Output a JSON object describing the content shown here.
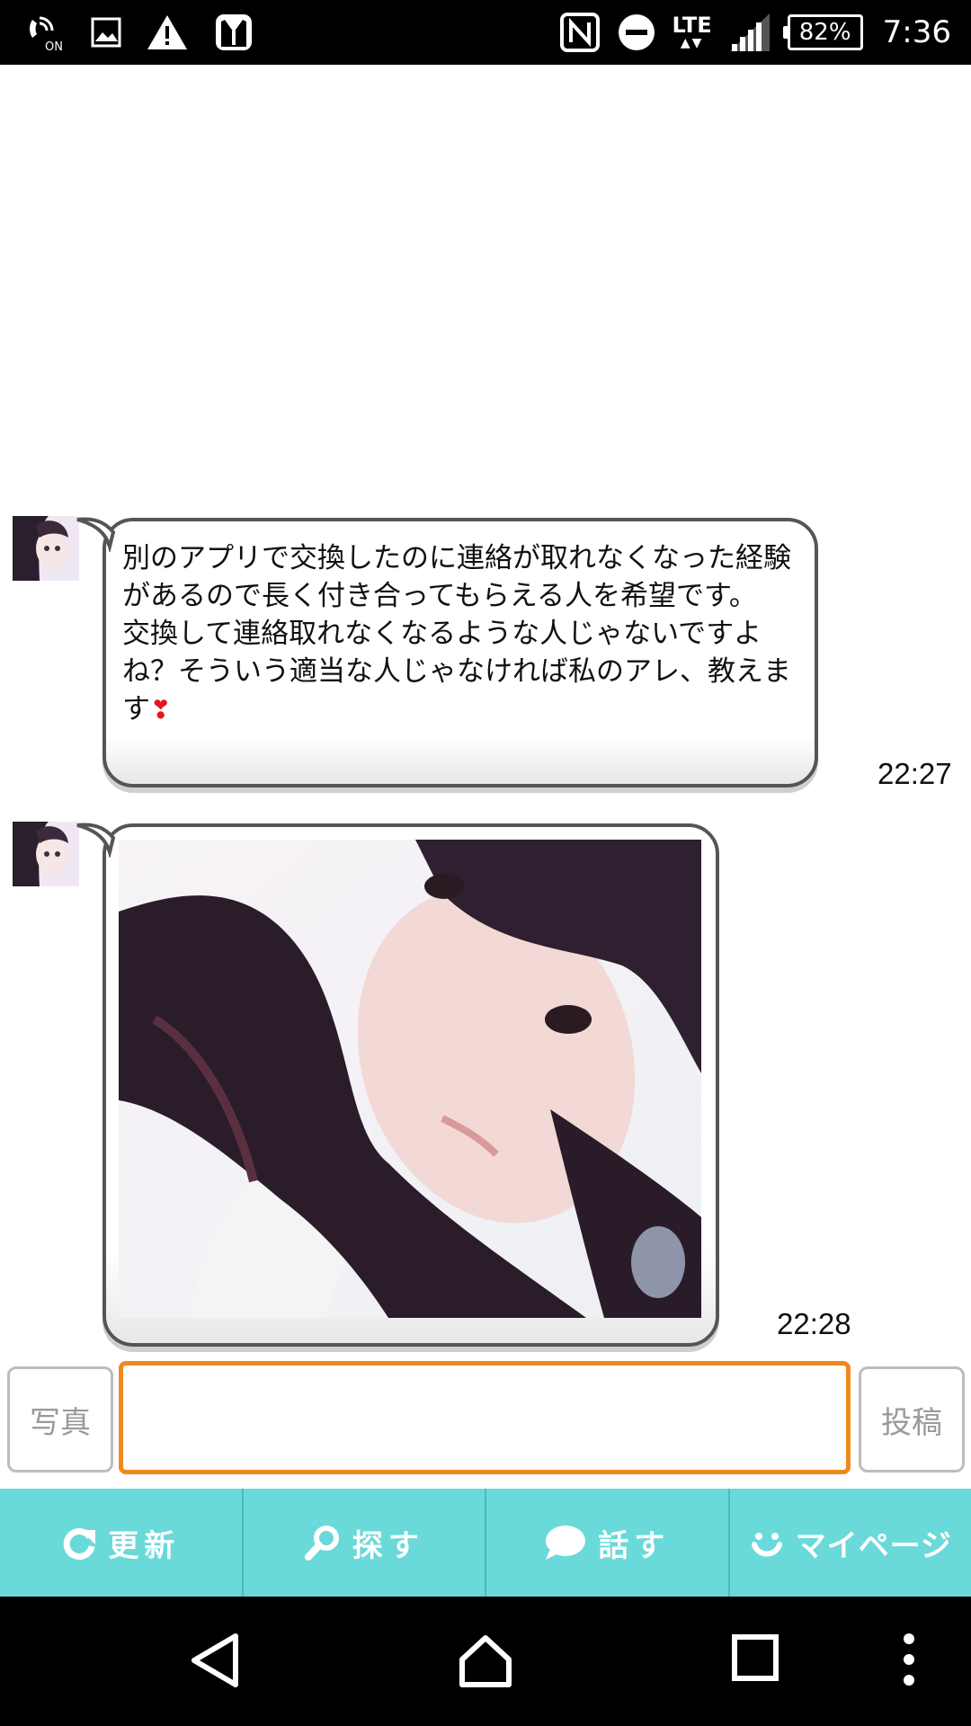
{
  "status_bar": {
    "time": "7:36",
    "battery": "82%",
    "network": "LTE",
    "nfc_label": "N",
    "icons_left": [
      "wifi-calling-icon",
      "image-icon",
      "warning-icon",
      "tuxedo-icon"
    ],
    "icons_right": [
      "nfc-icon",
      "do-not-disturb-icon",
      "lte-icon",
      "signal-icon",
      "battery-icon"
    ]
  },
  "chat": {
    "messages": [
      {
        "type": "text",
        "text": "別のアプリで交換したのに連絡が取れなくなった経験があるので長く付き合ってもらえる人を希望です。\n交換して連絡取れなくなるような人じゃないですよね？そういう適当な人じゃなければ私のアレ、教えます",
        "emoji": "❣",
        "time": "22:27"
      },
      {
        "type": "photo",
        "time": "22:28"
      }
    ]
  },
  "input_bar": {
    "photo_button": "写真",
    "message_value": "",
    "post_button": "投稿"
  },
  "bottom_nav": {
    "items": [
      {
        "icon": "refresh-icon",
        "label": "更新"
      },
      {
        "icon": "search-icon",
        "label": "探す"
      },
      {
        "icon": "chat-bubble-icon",
        "label": "話す"
      },
      {
        "icon": "smiley-icon",
        "label": "マイページ"
      }
    ]
  },
  "colors": {
    "nav_background": "#6ad9d9",
    "input_border": "#f0891c",
    "heart": "#e8141a",
    "bubble_border": "#555555"
  }
}
